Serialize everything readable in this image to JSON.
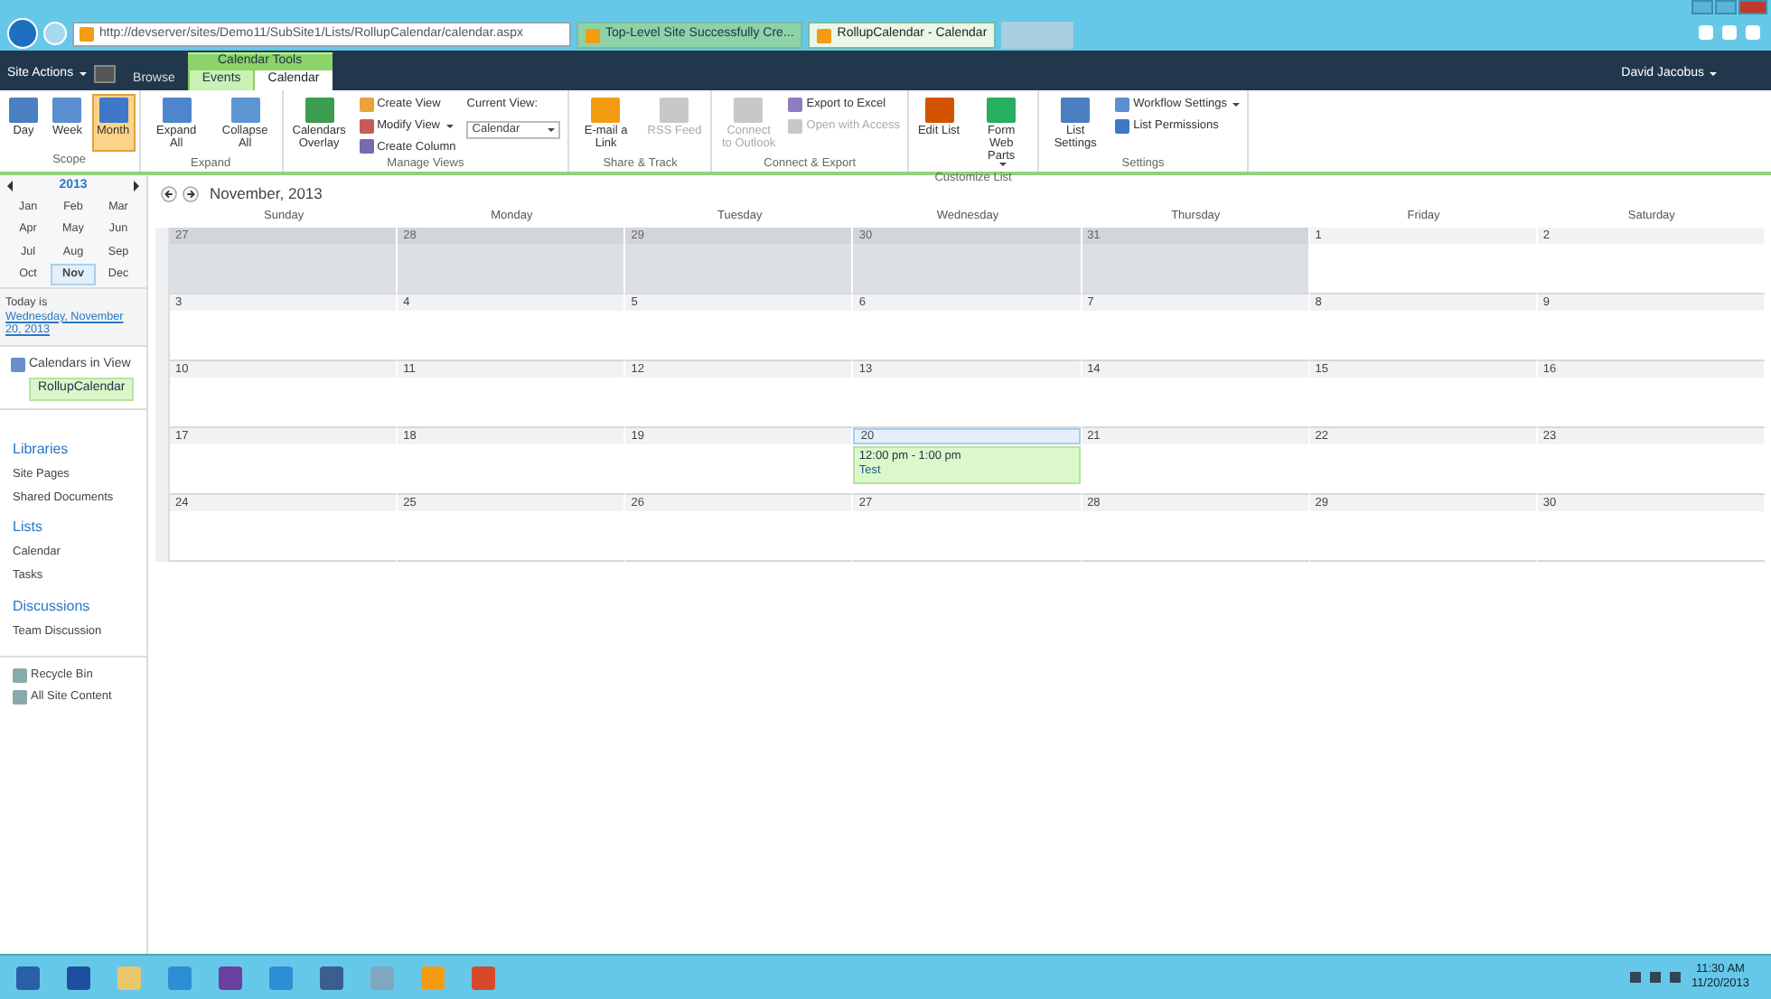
{
  "browser": {
    "address": "http://devserver/sites/Demo11/SubSite1/Lists/RollupCalendar/calendar.aspx",
    "tabs": [
      {
        "label": "Top-Level Site Successfully Cre...",
        "selected": false
      },
      {
        "label": "RollupCalendar - Calendar",
        "selected": true
      }
    ]
  },
  "top_bar": {
    "site_actions": "Site Actions",
    "context_group": "Calendar Tools",
    "user": "David Jacobus",
    "tabs": [
      {
        "label": "Browse",
        "selected": false,
        "contextual": false
      },
      {
        "label": "Events",
        "selected": false,
        "contextual": true
      },
      {
        "label": "Calendar",
        "selected": true,
        "contextual": true
      }
    ]
  },
  "ribbon": {
    "groups": [
      {
        "label": "Scope",
        "items": [
          {
            "kind": "large",
            "label": "Day",
            "selected": false,
            "disabled": false
          },
          {
            "kind": "large",
            "label": "Week",
            "selected": false,
            "disabled": false
          },
          {
            "kind": "large",
            "label": "Month",
            "selected": true,
            "disabled": false
          }
        ]
      },
      {
        "label": "Expand",
        "items": [
          {
            "kind": "large",
            "label": "Expand All",
            "selected": false,
            "disabled": false
          },
          {
            "kind": "large",
            "label": "Collapse All",
            "selected": false,
            "disabled": false
          }
        ]
      },
      {
        "label": "Manage Views",
        "items": [
          {
            "kind": "large",
            "label": "Calendars Overlay",
            "selected": false,
            "disabled": false
          },
          {
            "kind": "small",
            "label": "Create View",
            "disabled": false
          },
          {
            "kind": "small",
            "label": "Modify View",
            "disabled": false,
            "menu": true
          },
          {
            "kind": "small",
            "label": "Create Column",
            "disabled": false
          },
          {
            "kind": "dropdown",
            "label": "Current View:",
            "value": "Calendar",
            "disabled": false
          }
        ]
      },
      {
        "label": "Share & Track",
        "items": [
          {
            "kind": "large",
            "label": "E-mail a Link",
            "selected": false,
            "disabled": false
          },
          {
            "kind": "large",
            "label": "RSS Feed",
            "selected": false,
            "disabled": true
          }
        ]
      },
      {
        "label": "Connect & Export",
        "items": [
          {
            "kind": "large",
            "label": "Connect to Outlook",
            "selected": false,
            "disabled": true
          },
          {
            "kind": "small",
            "label": "Export to Excel",
            "disabled": false
          },
          {
            "kind": "small",
            "label": "Open with Access",
            "disabled": true
          }
        ]
      },
      {
        "label": "Customize List",
        "items": [
          {
            "kind": "large",
            "label": "Edit List",
            "selected": false,
            "disabled": false
          },
          {
            "kind": "large",
            "label": "Form Web Parts",
            "selected": false,
            "disabled": false,
            "menu": true
          }
        ]
      },
      {
        "label": "Settings",
        "items": [
          {
            "kind": "large",
            "label": "List Settings",
            "selected": false,
            "disabled": false
          },
          {
            "kind": "small",
            "label": "Workflow Settings",
            "disabled": false,
            "menu": true
          },
          {
            "kind": "small",
            "label": "List Permissions",
            "disabled": false
          }
        ]
      }
    ]
  },
  "date_picker": {
    "year": "2013",
    "months": [
      {
        "label": "Jan",
        "selected": false
      },
      {
        "label": "Feb",
        "selected": false
      },
      {
        "label": "Mar",
        "selected": false
      },
      {
        "label": "Apr",
        "selected": false
      },
      {
        "label": "May",
        "selected": false
      },
      {
        "label": "Jun",
        "selected": false
      },
      {
        "label": "Jul",
        "selected": false
      },
      {
        "label": "Aug",
        "selected": false
      },
      {
        "label": "Sep",
        "selected": false
      },
      {
        "label": "Oct",
        "selected": false
      },
      {
        "label": "Nov",
        "selected": true
      },
      {
        "label": "Dec",
        "selected": false
      }
    ],
    "today_label": "Today is",
    "today_date": "Wednesday, November 20, 2013"
  },
  "calendars_in_view": {
    "label": "Calendars in View",
    "calendars": [
      "RollupCalendar"
    ]
  },
  "sidebar": {
    "sections": [
      {
        "heading": "Libraries",
        "items": [
          "Site Pages",
          "Shared Documents"
        ]
      },
      {
        "heading": "Lists",
        "items": [
          "Calendar",
          "Tasks"
        ]
      },
      {
        "heading": "Discussions",
        "items": [
          "Team Discussion"
        ]
      }
    ],
    "footer_items": [
      "Recycle Bin",
      "All Site Content"
    ]
  },
  "calendar": {
    "title": "November, 2013",
    "weekdays": [
      "Sunday",
      "Monday",
      "Tuesday",
      "Wednesday",
      "Thursday",
      "Friday",
      "Saturday"
    ],
    "weeks": [
      {
        "days": [
          {
            "date": "27",
            "in_month": false,
            "today": false
          },
          {
            "date": "28",
            "in_month": false,
            "today": false
          },
          {
            "date": "29",
            "in_month": false,
            "today": false
          },
          {
            "date": "30",
            "in_month": false,
            "today": false
          },
          {
            "date": "31",
            "in_month": false,
            "today": false
          },
          {
            "date": "1",
            "in_month": true,
            "today": false
          },
          {
            "date": "2",
            "in_month": true,
            "today": false
          }
        ]
      },
      {
        "days": [
          {
            "date": "3",
            "in_month": true,
            "today": false
          },
          {
            "date": "4",
            "in_month": true,
            "today": false
          },
          {
            "date": "5",
            "in_month": true,
            "today": false
          },
          {
            "date": "6",
            "in_month": true,
            "today": false
          },
          {
            "date": "7",
            "in_month": true,
            "today": false
          },
          {
            "date": "8",
            "in_month": true,
            "today": false
          },
          {
            "date": "9",
            "in_month": true,
            "today": false
          }
        ]
      },
      {
        "days": [
          {
            "date": "10",
            "in_month": true,
            "today": false
          },
          {
            "date": "11",
            "in_month": true,
            "today": false
          },
          {
            "date": "12",
            "in_month": true,
            "today": false
          },
          {
            "date": "13",
            "in_month": true,
            "today": false
          },
          {
            "date": "14",
            "in_month": true,
            "today": false
          },
          {
            "date": "15",
            "in_month": true,
            "today": false
          },
          {
            "date": "16",
            "in_month": true,
            "today": false
          }
        ]
      },
      {
        "days": [
          {
            "date": "17",
            "in_month": true,
            "today": false
          },
          {
            "date": "18",
            "in_month": true,
            "today": false
          },
          {
            "date": "19",
            "in_month": true,
            "today": false
          },
          {
            "date": "20",
            "in_month": true,
            "today": true,
            "events": [
              {
                "time": "12:00 pm - 1:00 pm",
                "title": "Test"
              }
            ]
          },
          {
            "date": "21",
            "in_month": true,
            "today": false
          },
          {
            "date": "22",
            "in_month": true,
            "today": false
          },
          {
            "date": "23",
            "in_month": true,
            "today": false
          }
        ]
      },
      {
        "days": [
          {
            "date": "24",
            "in_month": true,
            "today": false
          },
          {
            "date": "25",
            "in_month": true,
            "today": false
          },
          {
            "date": "26",
            "in_month": true,
            "today": false
          },
          {
            "date": "27",
            "in_month": true,
            "today": false
          },
          {
            "date": "28",
            "in_month": true,
            "today": false
          },
          {
            "date": "29",
            "in_month": true,
            "today": false
          },
          {
            "date": "30",
            "in_month": true,
            "today": false
          }
        ]
      }
    ]
  },
  "taskbar": {
    "time": "11:30 AM",
    "date": "11/20/2013"
  }
}
